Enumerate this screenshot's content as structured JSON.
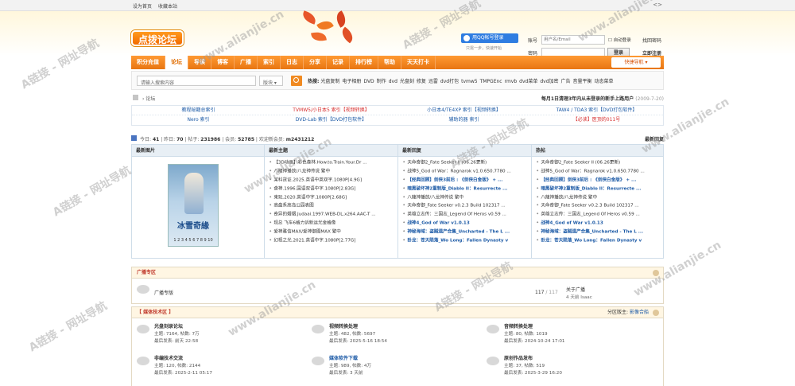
{
  "topbar": {
    "set_home": "设为首页",
    "bookmark": "收藏本站",
    "arrows": "<>"
  },
  "logo": {
    "text": "点拨论坛"
  },
  "qq": {
    "button": "用QQ帐号登录",
    "sub": "只需一步，快速开始"
  },
  "login": {
    "user_label": "账号",
    "user_placeholder": "用户名/Email",
    "pass_label": "密码",
    "auto_login": "自动登录",
    "find_pass": "找回密码",
    "login_btn": "登录",
    "register": "立即注册"
  },
  "nav": {
    "items": [
      "积分充值",
      "论坛",
      "导读",
      "博客",
      "广播",
      "索引",
      "日志",
      "分享",
      "记录",
      "排行榜",
      "帮助",
      "天天打卡"
    ],
    "active_index": 1,
    "quick": "快捷导航 ▾"
  },
  "search": {
    "placeholder": "请输入搜索内容",
    "select": "版块 ▾",
    "hot_label": "热搜:",
    "hot": [
      "光盘复制",
      "电子相册",
      "DVD",
      "制作",
      "dvd",
      "光盘刻",
      "修复",
      "迅雷",
      "dvd打包",
      "tvmw5",
      "TMPGEnc",
      "rmvb",
      "dvd菜单",
      "dvd加密",
      "广告",
      "音量平衡",
      "动态菜单"
    ]
  },
  "breadcrumb": {
    "text": "论坛",
    "right": "每月1日清理3年内从未登录的新手上路用户",
    "right_date": "(2009-7-20)"
  },
  "index_table": [
    [
      {
        "text": "教程秘籍总索引",
        "color": "#1c5aa6"
      },
      {
        "text": "TVMW5/小日本5 索引【视频转换】",
        "color": "#d62e2e"
      },
      {
        "text": "小日本4/TE4XP 索引【视频转换】",
        "color": "#1c5aa6"
      },
      {
        "text": "TAW4 / TDA3 索引【DVD打包软件】",
        "color": "#1c5aa6"
      }
    ],
    [
      {
        "text": "Nero 索引",
        "color": "#1c5aa6"
      },
      {
        "text": "DVD-Lab 索引【DVD打包软件】",
        "color": "#1c5aa6"
      },
      {
        "text": "辅助的器 索引",
        "color": "#1c5aa6"
      },
      {
        "text": "【必读】医顶的011号",
        "color": "#d62e2e"
      }
    ]
  ],
  "stats": {
    "today_label": "今日:",
    "today": "41",
    "yesterday_label": "昨日:",
    "yesterday": "70",
    "posts_label": "帖子:",
    "posts": "231986",
    "members_label": "会员:",
    "members": "52785",
    "newest_label": "欢迎新会员:",
    "newest": "m2431212",
    "right": "最新回复"
  },
  "grid": {
    "heads": [
      "最新图片",
      "最新主题",
      "最新回复",
      "热帖"
    ],
    "poster": {
      "title": "冰雪奇緣",
      "pager": "1 2 3 4 5 6 7 8 9 10"
    },
    "new_topics": [
      "【3D动画】彩色森林.How.to.Train.Your.Dr ...",
      "八龍神播放/八龙神传说 繁中",
      "某科货证.2025.英语中英双字.1080P[4.9G]",
      "食神.1996.国语双语中字.1080P[2.83G]",
      "束玩.2020.英语中字.1080P[2.68G]",
      "高盘系高岛公园表图",
      "奇异的婚姻.Judaai.1997.WEB-DL.x264.AAC-T ...",
      "现总 飞车6格力诉新运光金格像",
      "爱神雅信MAX/爱神御图MAX 繁中",
      "幻视之光.2021.英语中字.1080P[2.77G]"
    ],
    "new_replies": [
      "天命奇御2_Fate Seeker II (06.26更新)",
      "战神5_God of War：Ragnarok v1.0.650.7780 ...",
      "【经典回顾】剑侠3前后 : 《剑侠白金版》 + ...",
      "暗黑破坏神2重制版_Diablo II：Resurrecte ...",
      "八龍神播放/八龙神传说 繁中",
      "天命奇御_Fate Seeker v0.2.3 Build 102317 ...",
      "英雄立志传：三国志_Legend Of Heros v0.59 ...",
      "战神4_God of War v1.0.13",
      "神秘海域：盗贼遗产合集_Uncharted - The L ...",
      "卧龙：苍天陨落_Wo Long：Fallen Dynasty v"
    ],
    "hot_posts": [
      "天命奇御2_Fate Seeker II (06.26更新)",
      "战神5_God of War：Ragnarok v1.0.650.7780 ...",
      "【经典回顾】剑侠3前后 : 《剑侠白金版》 + ...",
      "暗黑破坏神2重制版_Diablo II：Resurrecte ...",
      "八龍神播放/八龙神传说 繁中",
      "天命奇御_Fate Seeker v0.2.3 Build 102317 ...",
      "英雄立志传：三国志_Legend Of Heros v0.59 ...",
      "战神4_God of War v1.0.13",
      "神秘海域：盗贼遗产合集_Uncharted - The L ...",
      "卧龙：苍天陨落_Wo Long：Fallen Dynasty v"
    ]
  },
  "broadcast": {
    "head": "广播专区",
    "forum": "广播专版",
    "count": "117",
    "count_total": "/ 117",
    "last": "关于广播",
    "last2": "4 天前 Isaac"
  },
  "media": {
    "head": "【 媒体技术区 】",
    "mod_label": "分区版主:",
    "mod": "影像合船",
    "forums": [
      {
        "name": "光盘刻录论坛",
        "stat": "主题: 7164, 帖数: 7万",
        "last": "最后发表: 前天 22:58",
        "blue": false
      },
      {
        "name": "视频转换处理",
        "stat": "主题: 482, 帖数: 5697",
        "last": "最后发表: 2025-5-16 18:54",
        "blue": false
      },
      {
        "name": "音频转换处理",
        "stat": "主题: 80, 帖数: 1019",
        "last": "最后发表: 2024-10-24 17:01",
        "blue": false
      },
      {
        "name": "非编技术交流",
        "stat": "主题: 120, 帖数: 2144",
        "last": "最后发表: 2025-2-11 05:17",
        "blue": false
      },
      {
        "name": "媒体软件下载",
        "stat": "主题: 989, 帖数: 4万",
        "last": "最后发表: 3 天前",
        "blue": true
      },
      {
        "name": "原创作品发布",
        "stat": "主题: 37, 帖数: 519",
        "last": "最后发表: 2025-3-29 16:20",
        "blue": false
      }
    ]
  },
  "watermark": {
    "text1": "A链接 - 网址导航",
    "text2": "www.alianjie.cn"
  }
}
